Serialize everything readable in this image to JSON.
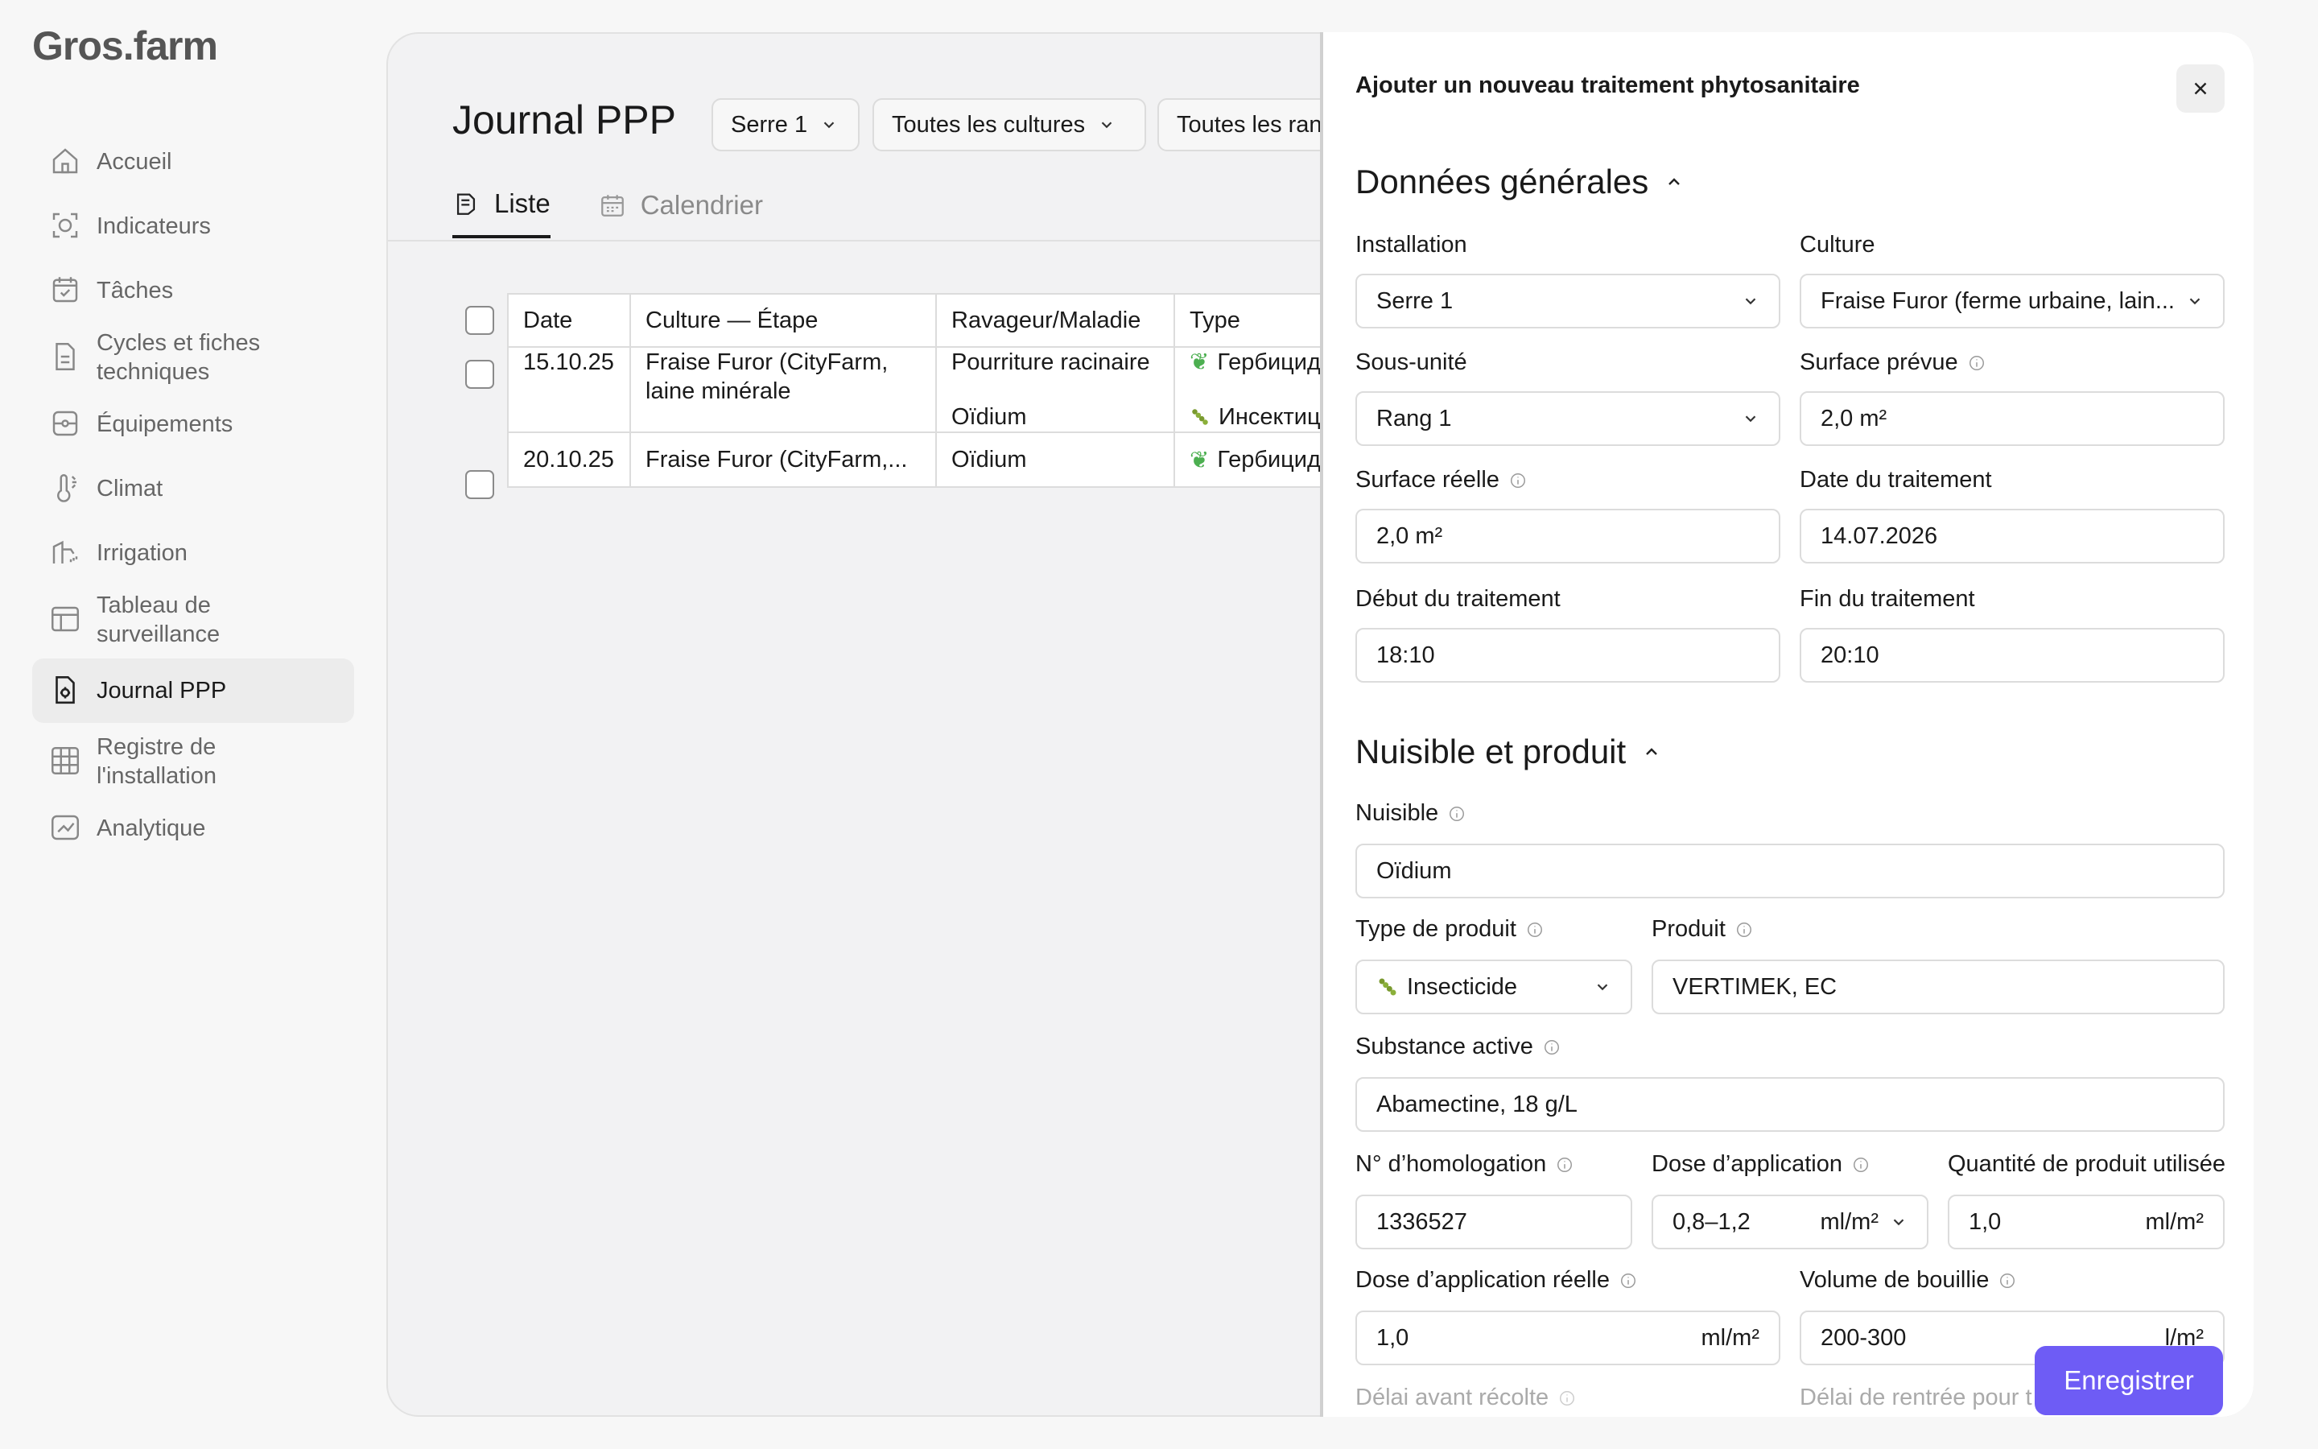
{
  "brand": {
    "logo": "Gros.farm"
  },
  "sidebar": {
    "items": [
      {
        "label": "Accueil",
        "icon": "home-icon",
        "active": false
      },
      {
        "label": "Indicateurs",
        "icon": "indicators-icon",
        "active": false
      },
      {
        "label": "Tâches",
        "icon": "tasks-icon",
        "active": false
      },
      {
        "label": "Cycles et fiches techniques",
        "icon": "document-icon",
        "active": false
      },
      {
        "label": "Équipements",
        "icon": "equipment-icon",
        "active": false
      },
      {
        "label": "Climat",
        "icon": "thermometer-icon",
        "active": false
      },
      {
        "label": "Irrigation",
        "icon": "irrigation-icon",
        "active": false
      },
      {
        "label": "Tableau de surveillance",
        "icon": "table-icon",
        "active": false
      },
      {
        "label": "Journal PPP",
        "icon": "journal-icon",
        "active": true
      },
      {
        "label": "Registre de l'installation",
        "icon": "grid-icon",
        "active": false
      },
      {
        "label": "Analytique",
        "icon": "chart-icon",
        "active": false
      }
    ]
  },
  "main": {
    "title": "Journal PPP",
    "filters": [
      "Serre 1",
      "Toutes les cultures",
      "Toutes les ran"
    ],
    "tabs": [
      {
        "label": "Liste",
        "active": true
      },
      {
        "label": "Calendrier",
        "active": false
      }
    ],
    "table": {
      "headers": [
        "Date",
        "Culture — Étape",
        "Ravageur/Maladie",
        "Type"
      ],
      "rows": [
        {
          "date": "15.10.25",
          "culture_line1": "Fraise Furor (CityFarm,",
          "culture_line2": "laine minérale",
          "pest1": "Pourriture racinaire",
          "type1": "Гербицид",
          "pest2": "Oïdium",
          "type2": "Инсектици"
        },
        {
          "date": "20.10.25",
          "culture": "Fraise Furor (CityFarm,...",
          "pest": "Oïdium",
          "type": "Гербицид"
        }
      ]
    }
  },
  "drawer": {
    "title": "Ajouter un nouveau traitement phytosanitaire",
    "section1": "Données générales",
    "section2": "Nuisible et produit",
    "fields": {
      "installation": {
        "label": "Installation",
        "value": "Serre 1"
      },
      "culture": {
        "label": "Culture",
        "value": "Fraise Furor (ferme urbaine, lain..."
      },
      "sous_unite": {
        "label": "Sous-unité",
        "value": "Rang 1"
      },
      "surface_prevue": {
        "label": "Surface prévue",
        "value": "2,0 m²"
      },
      "surface_reelle": {
        "label": "Surface réelle",
        "value": "2,0 m²"
      },
      "date_traitement": {
        "label": "Date du traitement",
        "value": "14.07.2026"
      },
      "debut": {
        "label": "Début du traitement",
        "value": "18:10"
      },
      "fin": {
        "label": "Fin du traitement",
        "value": "20:10"
      },
      "nuisible": {
        "label": "Nuisible",
        "value": "Oïdium"
      },
      "type_produit": {
        "label": "Type de produit",
        "value": "Insecticide"
      },
      "produit": {
        "label": "Produit",
        "value": "VERTIMEK, EC"
      },
      "substance": {
        "label": "Substance active",
        "value": "Abamectine, 18 g/L"
      },
      "homologation": {
        "label": "N° d’homologation",
        "value": "1336527"
      },
      "dose": {
        "label": "Dose d’application",
        "value": "0,8–1,2",
        "unit": "ml/m²"
      },
      "quantite": {
        "label": "Quantité de produit utilisée",
        "value": "1,0",
        "unit": "ml/m²"
      },
      "dose_reelle": {
        "label": "Dose d’application réelle",
        "value": "1,0",
        "unit": "ml/m²"
      },
      "volume": {
        "label": "Volume de bouillie",
        "value": "200-300",
        "unit": "l/m²"
      },
      "delai_recolte": {
        "label": "Délai avant récolte"
      },
      "delai_rentree": {
        "label": "Délai de rentrée pour t"
      }
    },
    "save_label": "Enregistrer"
  },
  "colors": {
    "accent": "#6e5cf5",
    "active_nav": "#ececec",
    "herbicide": "#4caf50"
  }
}
